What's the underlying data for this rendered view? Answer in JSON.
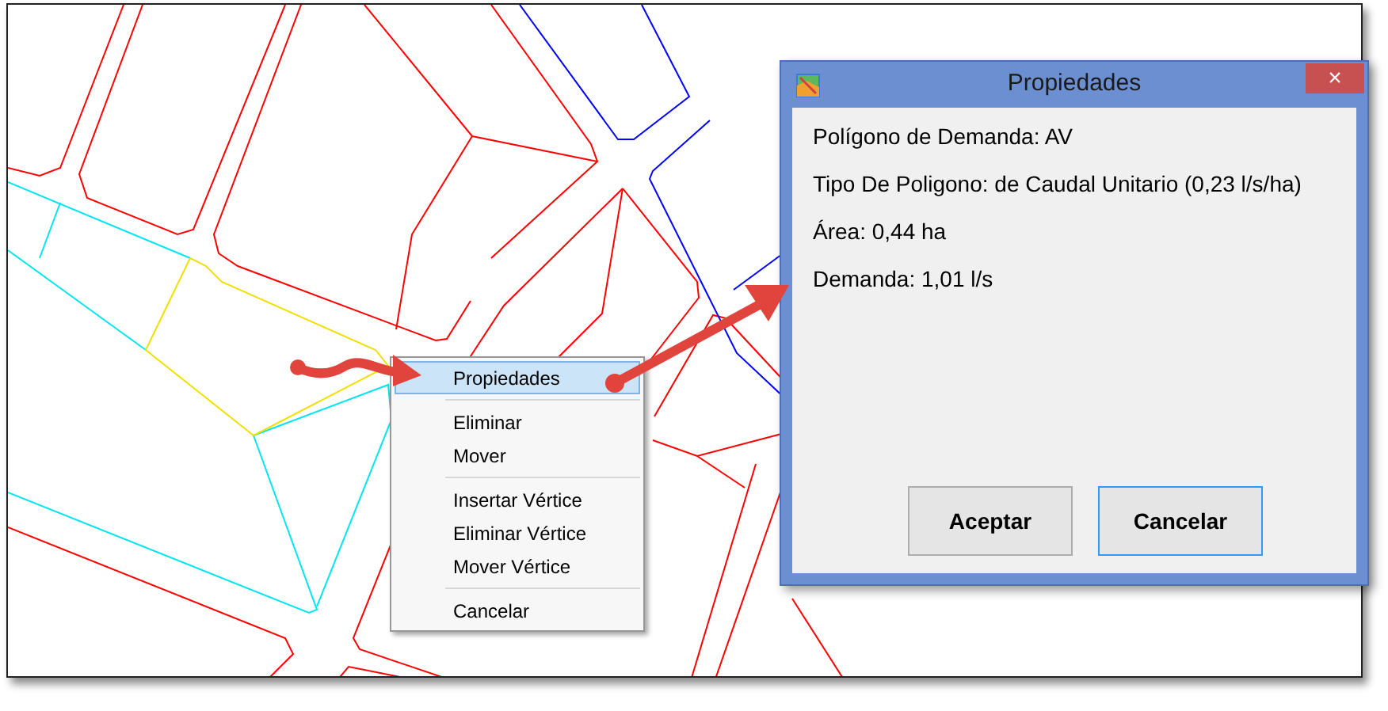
{
  "context_menu": {
    "groups": [
      [
        {
          "label": "Propiedades",
          "selected": true
        }
      ],
      [
        {
          "label": "Eliminar",
          "selected": false
        },
        {
          "label": "Mover",
          "selected": false
        }
      ],
      [
        {
          "label": "Insertar Vértice",
          "selected": false
        },
        {
          "label": "Eliminar Vértice",
          "selected": false
        },
        {
          "label": "Mover Vértice",
          "selected": false
        }
      ],
      [
        {
          "label": "Cancelar",
          "selected": false
        }
      ]
    ]
  },
  "dialog": {
    "title": "Propiedades",
    "close": "×",
    "lines": [
      "Polígono de Demanda: AV",
      "Tipo De Poligono: de Caudal Unitario (0,23 l/s/ha)",
      "Área: 0,44 ha",
      "Demanda: 1,01 l/s"
    ],
    "buttons": [
      {
        "label": "Aceptar",
        "focused": false
      },
      {
        "label": "Cancelar",
        "focused": true
      }
    ]
  }
}
